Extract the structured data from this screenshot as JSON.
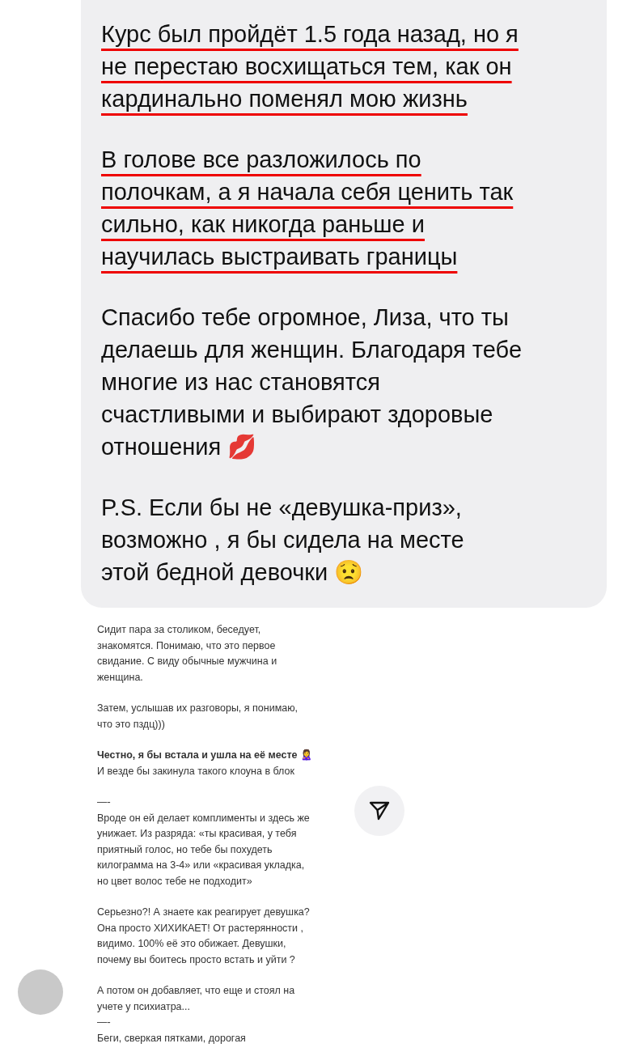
{
  "message": {
    "paragraphs": [
      {
        "text": "Курс был пройдёт 1.5 года назад, но я\nне перестаю восхищаться тем, как он\nкардинально поменял мою жизнь",
        "underlined": true
      },
      {
        "text": "В голове все разложилось по\nполочкам, а я начала себя ценить так\nсильно, как никогда раньше и\nнаучилась выстраивать границы",
        "underlined": true
      },
      {
        "text": "Спасибо тебе огромное, Лиза, что ты\nделаешь для женщин. Благодаря тебе\nмногие из нас становятся\nсчастливыми и выбирают здоровые\nотношения 💋",
        "underlined": false
      },
      {
        "text": "P.S. Если бы не «девушка-приз»,\nвозможно , я бы сидела на месте\nэтой бедной девочки 😟",
        "underlined": false
      }
    ]
  },
  "post": {
    "paragraphs": [
      "Сидит пара за столиком, беседует,\nзнакомятся. Понимаю, что это первое\nсвидание. С виду обычные мужчина и\nженщина.",
      "Затем, услышав их разговоры, я понимаю,\nчто это пздц)))",
      "**Честно, я бы встала и ушла на её месте 🙎‍♀️**\nИ везде бы закинула такого клоуна в блок",
      "—-\nВроде он ей делает комплименты и здесь же\nунижает. Из разряда: «ты красивая, у тебя\nприятный голос, но тебе бы похудеть\nкилограмма на 3-4» или «красивая укладка,\nно цвет волос тебе не подходит»",
      "Серьезно?! А знаете как реагирует девушка?\nОна просто ХИХИКАЕТ! От растерянности ,\nвидимо. 100% её это обижает. Девушки,\nпочему вы боитесь просто встать и уйти ?",
      "А потом он добавляет, что еще и стоял на\nучете у психиатра...\n—-\nБеги, сверкая пятками, дорогая"
    ]
  }
}
